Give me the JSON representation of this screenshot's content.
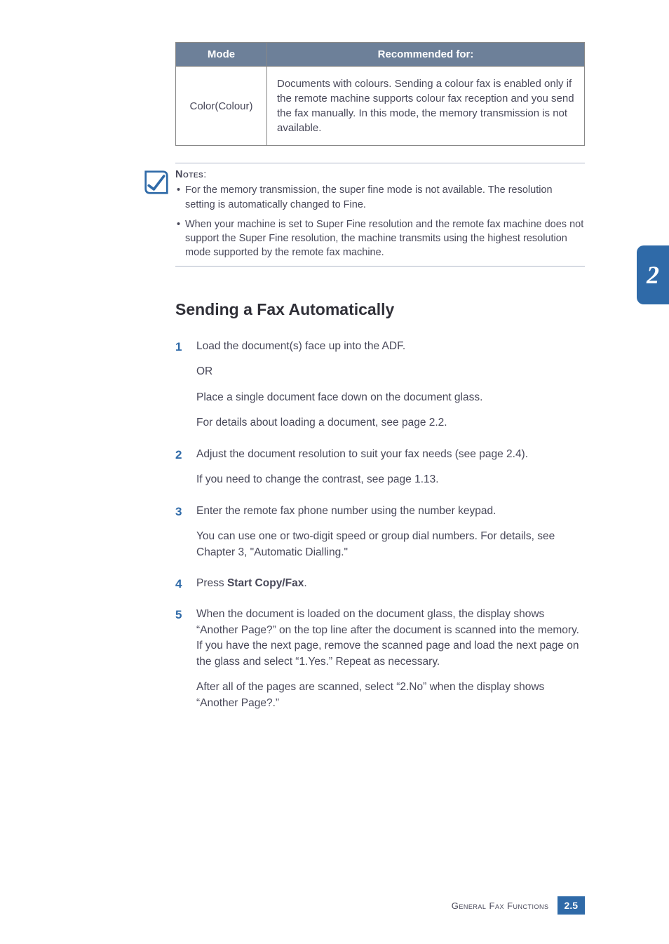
{
  "table": {
    "headers": {
      "col1": "Mode",
      "col2": "Recommended for:"
    },
    "row": {
      "mode": "Color(Colour)",
      "desc": "Documents with colours. Sending a colour fax is enabled only if the remote machine supports colour fax reception and you send the fax manually. In this mode, the memory transmission is not available."
    }
  },
  "notes": {
    "title": "Notes",
    "items": [
      "For the memory transmission, the super fine mode is not available. The resolution setting is automatically changed to Fine.",
      "When your machine is set to Super Fine resolution and the remote fax machine does not support the Super Fine resolution, the machine transmits using the highest resolution mode supported by the remote fax machine."
    ]
  },
  "section_heading": "Sending a Fax Automatically",
  "steps": {
    "s1": {
      "num": "1",
      "p1": "Load the document(s) face up into the ADF.",
      "p2": "OR",
      "p3": "Place a single document face down on the document glass.",
      "p4": "For details about loading a document, see page 2.2."
    },
    "s2": {
      "num": "2",
      "p1": "Adjust the document resolution to suit your fax needs (see page 2.4).",
      "p2": "If you need to change the contrast, see page 1.13."
    },
    "s3": {
      "num": "3",
      "p1": "Enter the remote fax phone number using the number keypad.",
      "p2": "You can use one or two-digit speed or group dial numbers. For details, see Chapter 3, \"Automatic Dialling.\""
    },
    "s4": {
      "num": "4",
      "pre": "Press ",
      "bold": "Start Copy/Fax",
      "post": "."
    },
    "s5": {
      "num": "5",
      "p1": "When the document is loaded on the document glass, the display shows “Another Page?” on the top line after the document is scanned into the memory. If you have the next page, remove the scanned page and load the next page on the glass and select “1.Yes.” Repeat as necessary.",
      "p2": "After all of the pages are scanned, select “2.No” when the display shows “Another Page?.”"
    }
  },
  "side_tab": "2",
  "footer": {
    "label": "General Fax Functions",
    "page": "2.5"
  }
}
